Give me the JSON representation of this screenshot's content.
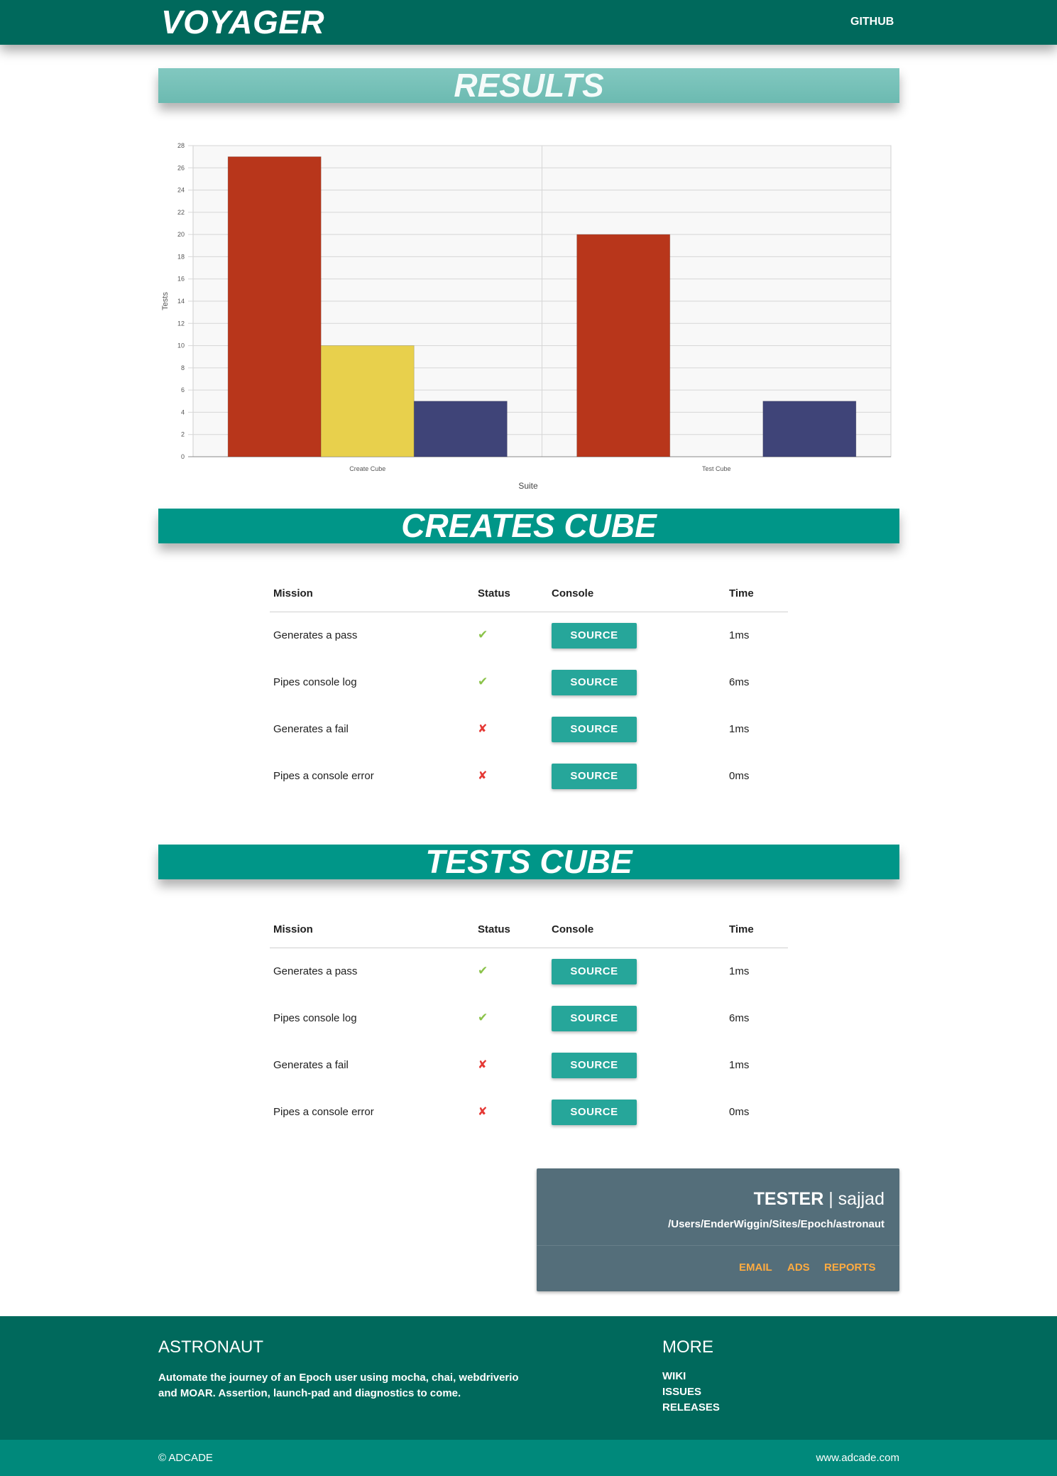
{
  "navbar": {
    "brand": "VOYAGER",
    "github_label": "GITHUB"
  },
  "sections": {
    "results_title": "RESULTS",
    "creates_title": "CREATES CUBE",
    "tests_title": "TESTS CUBE"
  },
  "chart_data": {
    "type": "bar",
    "categories": [
      "Create Cube",
      "Test Cube"
    ],
    "series": [
      {
        "values": [
          27,
          20
        ],
        "color": "#b8361b"
      },
      {
        "values": [
          10,
          0
        ],
        "color": "#e8d04c"
      },
      {
        "values": [
          5,
          5
        ],
        "color": "#3f4478"
      }
    ],
    "xlabel": "Suite",
    "ylabel": "Tests",
    "ylim": [
      0,
      28
    ],
    "yticks": [
      "0",
      "2",
      "4",
      "6",
      "8",
      "10",
      "12",
      "14",
      "16",
      "18",
      "20",
      "22",
      "24",
      "26",
      "28"
    ],
    "grid": true
  },
  "table_headers": {
    "mission": "Mission",
    "status": "Status",
    "console": "Console",
    "time": "Time"
  },
  "status_icons": {
    "pass": "✔",
    "fail": "✘",
    "pass_color": "#8bc34a",
    "fail_color": "#e53935"
  },
  "creates_cube": {
    "rows": [
      {
        "mission": "Generates a pass",
        "status": "✔",
        "console": "SOURCE",
        "time": "1ms"
      },
      {
        "mission": "Pipes console log",
        "status": "✔",
        "console": "SOURCE",
        "time": "6ms"
      },
      {
        "mission": "Generates a fail",
        "status": "✘",
        "console": "SOURCE",
        "time": "1ms"
      },
      {
        "mission": "Pipes a console error",
        "status": "✘",
        "console": "SOURCE",
        "time": "0ms"
      }
    ]
  },
  "tests_cube": {
    "rows": [
      {
        "mission": "Generates a pass",
        "status": "✔",
        "console": "SOURCE",
        "time": "1ms"
      },
      {
        "mission": "Pipes console log",
        "status": "✔",
        "console": "SOURCE",
        "time": "6ms"
      },
      {
        "mission": "Generates a fail",
        "status": "✘",
        "console": "SOURCE",
        "time": "1ms"
      },
      {
        "mission": "Pipes a console error",
        "status": "✘",
        "console": "SOURCE",
        "time": "0ms"
      }
    ]
  },
  "tester": {
    "label": "TESTER",
    "separator": "|",
    "name": "sajjad",
    "path": "/Users/EnderWiggin/Sites/Epoch/astronaut",
    "links": [
      "EMAIL",
      "ADS",
      "REPORTS"
    ]
  },
  "footer": {
    "title": "ASTRONAUT",
    "description": "Automate the journey of an Epoch user using mocha, chai, webdriverio and MOAR. Assertion, launch-pad and diagnostics to come.",
    "more_title": "MORE",
    "more_links": [
      "WIKI",
      "ISSUES",
      "RELEASES"
    ],
    "copyright": "© ADCADE",
    "website": "www.adcade.com"
  },
  "colors": {
    "primary_dark": "#00695c",
    "primary": "#009688",
    "accent": "#ffab40",
    "card": "#546e7a"
  }
}
